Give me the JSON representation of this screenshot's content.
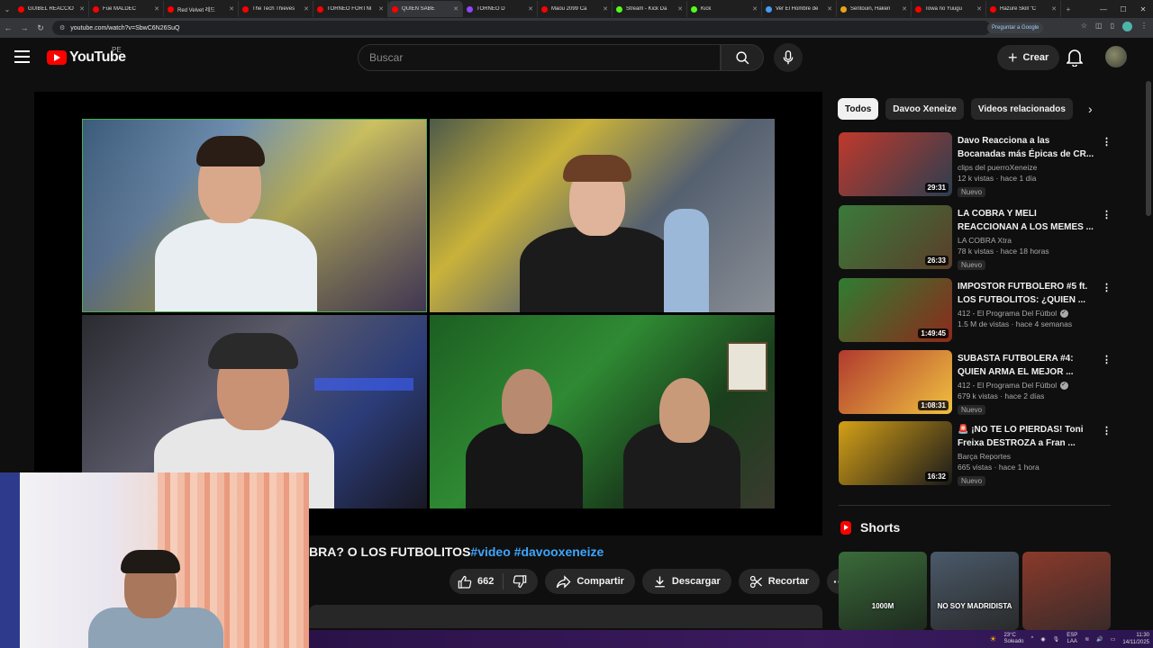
{
  "browser": {
    "tabs": [
      {
        "title": "GUIBEL REACCIO",
        "color": "#ff0000"
      },
      {
        "title": "Fue MALDEC",
        "color": "#ff0000"
      },
      {
        "title": "Red Velvet 레드",
        "color": "#ff0000"
      },
      {
        "title": "The Tech Thieves",
        "color": "#ff0000"
      },
      {
        "title": "TORNEO FORTNI",
        "color": "#ff0000"
      },
      {
        "title": "QUIEN SABE",
        "color": "#ff0000"
      },
      {
        "title": "TORNEO D",
        "color": "#9146ff"
      },
      {
        "title": "Maou 2099 Ca",
        "color": "#ff0000"
      },
      {
        "title": "Stream - Kick Da",
        "color": "#53fc18"
      },
      {
        "title": "Kick",
        "color": "#53fc18"
      },
      {
        "title": "Ver El Hombre de",
        "color": "#4a9af5"
      },
      {
        "title": "Sentouin, Haken",
        "color": "#e8a317"
      },
      {
        "title": "Towa no Yuugu",
        "color": "#ff0000"
      },
      {
        "title": "Hazure Skill \"C",
        "color": "#ff0000"
      }
    ],
    "active_tab_index": 5,
    "url": "youtube.com/watch?v=SbwC6N26SuQ",
    "google_pill": "Preguntar a Google"
  },
  "header": {
    "logo_text": "YouTube",
    "country_code": "PE",
    "search_placeholder": "Buscar",
    "create_label": "Crear"
  },
  "video": {
    "title_visible": "BRA? O LOS FUTBOLITOS",
    "hashtags": [
      "#video",
      "#davooxeneize"
    ],
    "like_count": "662",
    "share_label": "Compartir",
    "download_label": "Descargar",
    "clip_label": "Recortar"
  },
  "chips": [
    "Todos",
    "Davoo Xeneize",
    "Videos relacionados"
  ],
  "recommendations": [
    {
      "title": "Davo Reacciona a las Bocanadas más Épicas de CR...",
      "channel": "clips del puerroXeneize",
      "verified": false,
      "meta": "12 k vistas · hace 1 día",
      "badge": "Nuevo",
      "duration": "29:31",
      "colors": [
        "#c0392b",
        "#2c3e50"
      ]
    },
    {
      "title": "LA COBRA Y MELI REACCIONAN A LOS MEMES ...",
      "channel": "LA COBRA Xtra",
      "verified": false,
      "meta": "78 k vistas · hace 18 horas",
      "badge": "Nuevo",
      "duration": "26:33",
      "colors": [
        "#3a7a3a",
        "#5b3d2a"
      ]
    },
    {
      "title": "IMPOSTOR FUTBOLERO #5 ft. LOS FUTBOLITOS: ¿QUIEN ...",
      "channel": "412 - El Programa Del Fútbol",
      "verified": true,
      "meta": "1.5 M de vistas · hace 4 semanas",
      "badge": "",
      "duration": "1:49:45",
      "colors": [
        "#2e7d32",
        "#8d2a1c"
      ]
    },
    {
      "title": "SUBASTA FUTBOLERA #4: QUIEN ARMA EL MEJOR ...",
      "channel": "412 - El Programa Del Fútbol",
      "verified": true,
      "meta": "679 k vistas · hace 2 días",
      "badge": "Nuevo",
      "duration": "1:08:31",
      "colors": [
        "#b03a2e",
        "#f0c040"
      ]
    },
    {
      "title": "🚨 ¡NO TE LO PIERDAS! Toni Freixa DESTROZA a Fran ...",
      "channel": "Barça Reportes",
      "verified": false,
      "meta": "665 vistas · hace 1 hora",
      "badge": "Nuevo",
      "duration": "16:32",
      "colors": [
        "#d4a017",
        "#1a1a1a"
      ]
    }
  ],
  "shorts": {
    "heading": "Shorts",
    "items": [
      {
        "caption": "1000M",
        "colors": [
          "#3a6b3a",
          "#1e2a1e"
        ]
      },
      {
        "caption": "NO SOY MADRIDISTA",
        "colors": [
          "#4a5a6a",
          "#2a2a2a"
        ]
      },
      {
        "caption": "",
        "colors": [
          "#8a3a2a",
          "#3a2a2a"
        ]
      }
    ]
  },
  "taskbar": {
    "weather_temp": "23°C",
    "weather_desc": "Soleado",
    "lang": "ESP",
    "lang_sub": "LAA",
    "time": "11:30",
    "date": "14/11/2025"
  }
}
